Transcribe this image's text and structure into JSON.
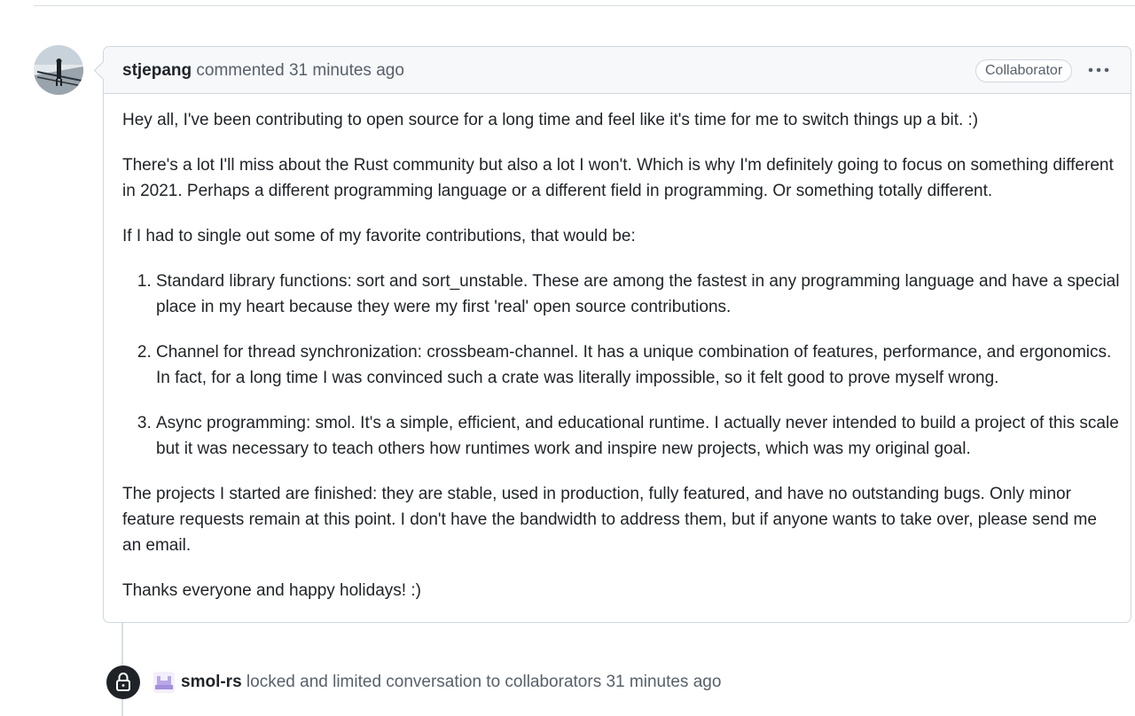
{
  "comment": {
    "author": "stjepang",
    "action": "commented",
    "time": "31 minutes ago",
    "role_badge": "Collaborator",
    "more_icon": "kebab-horizontal-icon",
    "avatar_icon": "avatar-photo-icon",
    "paragraphs": [
      "Hey all, I've been contributing to open source for a long time and feel like it's time for me to switch things up a bit. :)",
      "There's a lot I'll miss about the Rust community but also a lot I won't. Which is why I'm definitely going to focus on something different in 2021. Perhaps a different programming language or a different field in programming. Or something totally different.",
      "If I had to single out some of my favorite contributions, that would be:"
    ],
    "list_items": [
      "Standard library functions: sort and sort_unstable. These are among the fastest in any programming language and have a special place in my heart because they were my first 'real' open source contributions.",
      "Channel for thread synchronization: crossbeam-channel. It has a unique combination of features, performance, and ergonomics. In fact, for a long time I was convinced such a crate was literally impossible, so it felt good to prove myself wrong.",
      "Async programming: smol. It's a simple, efficient, and educational runtime. I actually never intended to build a project of this scale but it was necessary to teach others how runtimes work and inspire new projects, which was my original goal."
    ],
    "closing_paragraphs": [
      "The projects I started are finished: they are stable, used in production, fully featured, and have no outstanding bugs. Only minor feature requests remain at this point. I don't have the bandwidth to address them, but if anyone wants to take over, please send me an email.",
      "Thanks everyone and happy holidays! :)"
    ]
  },
  "timeline_event": {
    "icon": "lock-icon",
    "actor_avatar_icon": "org-avatar-icon",
    "actor": "smol-rs",
    "text": "locked and limited conversation to collaborators",
    "time": "31 minutes ago"
  },
  "colors": {
    "border": "#d0d7de",
    "header_background": "#f6f8fa",
    "text_primary": "#1f2328",
    "text_muted": "#57606a",
    "lock_badge": "#1f2328"
  }
}
